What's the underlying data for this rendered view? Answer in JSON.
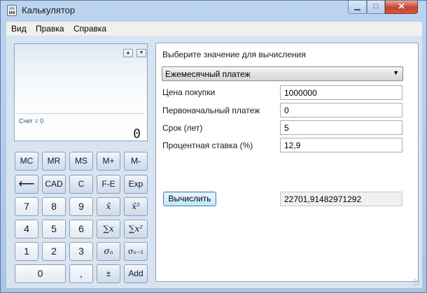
{
  "window": {
    "title": "Калькулятор",
    "minimize_glyph": "▁",
    "maximize_glyph": "□",
    "close_glyph": "✕"
  },
  "menu": {
    "items": [
      "Вид",
      "Правка",
      "Справка"
    ]
  },
  "display": {
    "memory_label": "Счет = 0",
    "value": "0",
    "scroll_up": "▲",
    "scroll_down": "▼"
  },
  "keypad": {
    "memory": [
      "MC",
      "MR",
      "MS",
      "M+",
      "M-"
    ],
    "row2": [
      "⟵",
      "CAD",
      "C",
      "F-E",
      "Exp"
    ],
    "row3": [
      "7",
      "8",
      "9",
      "x̄",
      "x̄²"
    ],
    "row4": [
      "4",
      "5",
      "6",
      "∑x",
      "∑x²"
    ],
    "row5": [
      "1",
      "2",
      "3",
      "σₙ",
      "σₙ₋₁"
    ],
    "row6": [
      "0",
      ",",
      "±",
      "Add"
    ]
  },
  "worksheet": {
    "prompt": "Выберите значение для вычисления",
    "select_value": "Ежемесячный платеж",
    "fields": [
      {
        "label": "Цена покупки",
        "value": "1000000"
      },
      {
        "label": "Первоначальный платеж",
        "value": "0"
      },
      {
        "label": "Срок (лет)",
        "value": "5"
      },
      {
        "label": "Процентная ставка (%)",
        "value": "12,9"
      }
    ],
    "calculate_label": "Вычислить",
    "result": "22701,91482971292"
  },
  "colors": {
    "accent": "#3c7fb1",
    "window_frame": "#b9d1ea",
    "close": "#c7432d"
  },
  "icons": {
    "app": "calculator-icon",
    "backspace": "backspace-arrow-icon",
    "dropdown": "chevron-down-icon"
  }
}
